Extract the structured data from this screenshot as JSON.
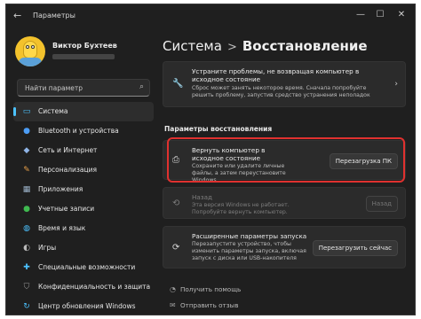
{
  "window": {
    "title": "Параметры",
    "back_icon": "back-arrow-icon",
    "controls": [
      "—",
      "☐",
      "✕"
    ]
  },
  "profile": {
    "name": "Виктор Бухтеев"
  },
  "search": {
    "placeholder": "Найти параметр"
  },
  "sidebar": {
    "items": [
      {
        "label": "Система",
        "icon": "monitor-icon",
        "color": "#4cc2ff",
        "active": true
      },
      {
        "label": "Bluetooth и устройства",
        "icon": "bluetooth-icon",
        "color": "#4c9df5"
      },
      {
        "label": "Сеть и Интернет",
        "icon": "network-icon",
        "color": "#8fb4e6"
      },
      {
        "label": "Персонализация",
        "icon": "brush-icon",
        "color": "#e8a04a"
      },
      {
        "label": "Приложения",
        "icon": "apps-icon",
        "color": "#9ab0c6"
      },
      {
        "label": "Учетные записи",
        "icon": "person-icon",
        "color": "#3fb950"
      },
      {
        "label": "Время и язык",
        "icon": "globe-icon",
        "color": "#4cc2ff"
      },
      {
        "label": "Игры",
        "icon": "gamepad-icon",
        "color": "#b9b9b9"
      },
      {
        "label": "Специальные возможности",
        "icon": "accessibility-icon",
        "color": "#4cc2ff"
      },
      {
        "label": "Конфиденциальность и защита",
        "icon": "shield-icon",
        "color": "#9a9a9a"
      },
      {
        "label": "Центр обновления Windows",
        "icon": "update-icon",
        "color": "#4cc2ff"
      }
    ]
  },
  "breadcrumb": {
    "parent": "Система",
    "separator": ">",
    "current": "Восстановление"
  },
  "troubleshoot": {
    "title": "Устраните проблемы, не возвращая компьютер в исходное состояние",
    "desc": "Сброс может занять некоторое время. Сначала попробуйте решить проблему, запустив средство устранения неполадок",
    "icon": "wrench-icon"
  },
  "section_title": "Параметры восстановления",
  "reset": {
    "title": "Вернуть компьютер в исходное состояние",
    "desc": "Сохраните или удалите личные файлы, а затем переустановите Windows",
    "button": "Перезагрузка ПК",
    "icon": "reset-pc-icon"
  },
  "goback": {
    "title": "Назад",
    "desc": "Эта версия Windows не работает. Попробуйте вернуть компьютер.",
    "button": "Назад",
    "icon": "history-icon"
  },
  "advanced": {
    "title": "Расширенные параметры запуска",
    "desc": "Перезапустите устройство, чтобы изменить параметры запуска, включая запуск с диска или USB-накопителя",
    "button": "Перезагрузить сейчас",
    "icon": "startup-icon"
  },
  "footer": {
    "help": "Получить помощь",
    "feedback": "Отправить отзыв"
  },
  "colors": {
    "highlight": "#e0312f",
    "accent": "#4cc2ff"
  }
}
